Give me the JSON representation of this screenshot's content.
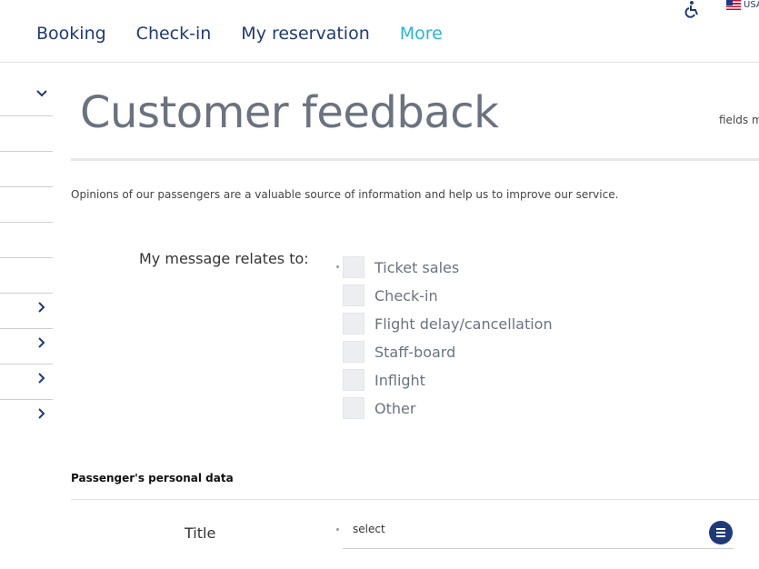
{
  "header": {
    "accessibility_icon": "wheelchair-icon",
    "locale_flag": "us-flag-icon",
    "locale_label": "USA",
    "nav": [
      {
        "label": "Booking"
      },
      {
        "label": "Check-in"
      },
      {
        "label": "My reservation"
      },
      {
        "label": "More"
      }
    ]
  },
  "sidebar": {
    "icons": [
      "chevron-down-icon",
      "chevron-right-icon"
    ]
  },
  "page": {
    "title": "Customer feedback",
    "fields_note": "fields m",
    "intro": "Opinions of our passengers are a valuable source of information and help us to improve our service."
  },
  "relates": {
    "label": "My message relates to:",
    "options": [
      {
        "label": "Ticket sales",
        "checked": false
      },
      {
        "label": "Check-in",
        "checked": false
      },
      {
        "label": "Flight delay/cancellation",
        "checked": false
      },
      {
        "label": "Staff-board",
        "checked": false
      },
      {
        "label": "Inflight",
        "checked": false
      },
      {
        "label": "Other",
        "checked": false
      }
    ]
  },
  "personal": {
    "section_title": "Passenger's personal data",
    "title_label": "Title",
    "title_select_value": "select",
    "select_icon": "menu-list-icon"
  },
  "colors": {
    "nav_text": "#1f3a78",
    "nav_accent": "#2ab5d6",
    "title_gray": "#6b7280"
  }
}
